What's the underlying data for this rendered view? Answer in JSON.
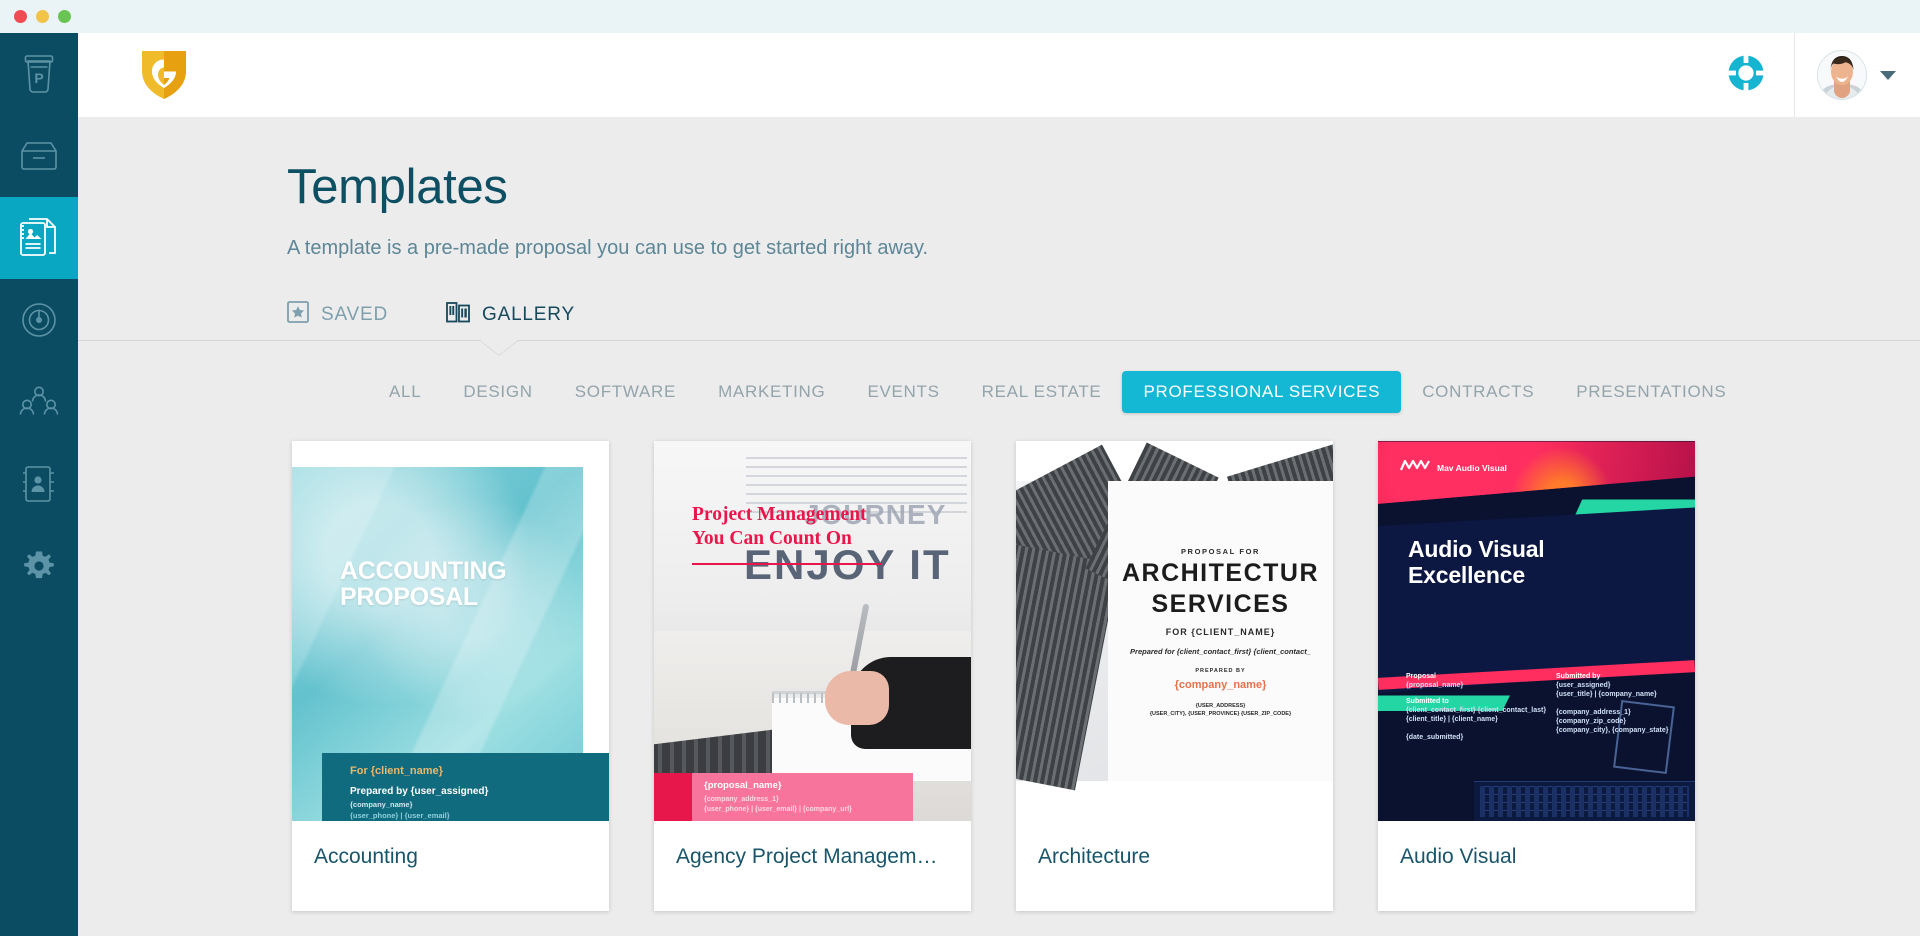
{
  "window": {
    "traffic_lights": [
      "close",
      "minimize",
      "maximize"
    ]
  },
  "sidebar": {
    "items": [
      {
        "icon": "coffee-cup-p-icon",
        "active": false
      },
      {
        "icon": "inbox-icon",
        "active": false
      },
      {
        "icon": "documents-icon",
        "active": true
      },
      {
        "icon": "dashboard-gauge-icon",
        "active": false
      },
      {
        "icon": "people-group-icon",
        "active": false
      },
      {
        "icon": "contacts-book-icon",
        "active": false
      },
      {
        "icon": "gear-icon",
        "active": false
      }
    ]
  },
  "header": {
    "logo": "g-shield-logo",
    "help_icon": "lifebuoy-icon",
    "avatar": "user-avatar",
    "caret": "chevron-down-icon"
  },
  "page": {
    "title": "Templates",
    "subtitle": "A template is a pre-made proposal you can use to get started right away."
  },
  "tabs": [
    {
      "label": "SAVED",
      "icon": "star-box-icon",
      "active": false
    },
    {
      "label": "GALLERY",
      "icon": "gallery-books-icon",
      "active": true
    }
  ],
  "categories": [
    {
      "label": "ALL",
      "active": false
    },
    {
      "label": "DESIGN",
      "active": false
    },
    {
      "label": "SOFTWARE",
      "active": false
    },
    {
      "label": "MARKETING",
      "active": false
    },
    {
      "label": "EVENTS",
      "active": false
    },
    {
      "label": "REAL ESTATE",
      "active": false
    },
    {
      "label": "PROFESSIONAL SERVICES",
      "active": true
    },
    {
      "label": "CONTRACTS",
      "active": false
    },
    {
      "label": "PRESENTATIONS",
      "active": false
    }
  ],
  "templates": [
    {
      "title": "Accounting",
      "cover": {
        "heading": "ACCOUNTING PROPOSAL",
        "for_line": "For {client_name}",
        "prepared_by": "Prepared by {user_assigned}",
        "company": "{company_name}",
        "contact": "{user_phone} | {user_email}"
      }
    },
    {
      "title": "Agency Project Management Se...",
      "cover": {
        "heading_line1": "Project Management",
        "heading_line2": "You Can Count On",
        "background_text": "ENJOY IT",
        "background_text_2": "JOURNEY",
        "proposal_name": "{proposal_name}",
        "company_address": "{company_address_1}",
        "contact": "{user_phone} | {user_email} | {company_url}"
      }
    },
    {
      "title": "Architecture",
      "cover": {
        "eyebrow": "PROPOSAL FOR",
        "heading_line1": "ARCHITECTUR",
        "heading_line2": "SERVICES",
        "for_client": "FOR {CLIENT_NAME}",
        "prepared_for": "Prepared for {client_contact_first} {client_contact_",
        "prepared_by_label": "PREPARED BY",
        "company": "{company_name}",
        "address": "{USER_ADDRESS}",
        "city_line": "{USER_CITY}, {USER_PROVINCE} {USER_ZIP_CODE}"
      }
    },
    {
      "title": "Audio Visual",
      "cover": {
        "brand": "Mav Audio Visual",
        "heading_line1": "Audio Visual",
        "heading_line2": "Excellence",
        "left": [
          {
            "label": "Proposal",
            "value": "{proposal_name}"
          },
          {
            "label": "Submitted to",
            "value": "{client_contact_first} {client_contact_last}"
          },
          {
            "label": "",
            "value": "{client_title} | {client_name}"
          },
          {
            "label": "",
            "value": "{date_submitted}"
          }
        ],
        "right": [
          {
            "label": "Submitted by",
            "value": "{user_assigned}"
          },
          {
            "label": "",
            "value": "{user_title} | {company_name}"
          },
          {
            "label": "",
            "value": "{company_address_1}"
          },
          {
            "label": "",
            "value": "{company_zip_code}"
          },
          {
            "label": "",
            "value": "{company_city}, {company_state}"
          }
        ]
      }
    }
  ],
  "colors": {
    "sidebar_bg": "#0b4c63",
    "accent_cyan": "#14b8d4",
    "title_teal": "#0d4f63",
    "body_bg": "#ececec",
    "logo_gold": "#e8b226"
  }
}
